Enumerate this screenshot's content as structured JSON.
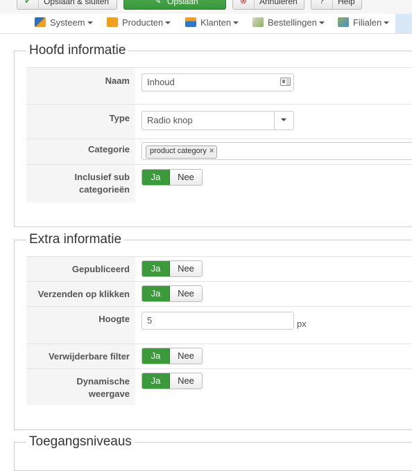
{
  "toolbar": {
    "save_close_label": "Opslaan & sluiten",
    "save_label": "Opslaan",
    "cancel_label": "Annuleren",
    "help_label": "Help"
  },
  "menu": {
    "items": [
      {
        "label": "Systeem",
        "icon": "tools-icon",
        "color": "#2f6fb3"
      },
      {
        "label": "Producten",
        "icon": "box-icon",
        "color": "#f0a01e"
      },
      {
        "label": "Klanten",
        "icon": "users-icon",
        "color": "#2e78c8"
      },
      {
        "label": "Bestellingen",
        "icon": "orders-icon",
        "color": "#8bb05a"
      },
      {
        "label": "Filialen",
        "icon": "stores-icon",
        "color": "#4a8fd0"
      }
    ]
  },
  "main_info": {
    "legend": "Hoofd informatie",
    "name_label": "Naam",
    "name_value": "Inhoud",
    "type_label": "Type",
    "type_value": "Radio knop",
    "category_label": "Categorie",
    "category_tag": "product category",
    "include_sub_label_1": "Inclusief sub",
    "include_sub_label_2": "categorieën",
    "yes": "Ja",
    "no": "Nee"
  },
  "extra_info": {
    "legend": "Extra informatie",
    "published_label": "Gepubliceerd",
    "submit_on_click_label": "Verzenden op klikken",
    "height_label": "Hoogte",
    "height_value": "5",
    "height_unit": "px",
    "removable_label": "Verwijderbare filter",
    "dynamic_label_1": "Dynamische",
    "dynamic_label_2": "weergave",
    "yes": "Ja",
    "no": "Nee"
  },
  "access": {
    "legend": "Toegangsniveaus"
  },
  "colors": {
    "active_green": "#3c9a3c",
    "label_bg": "#f5f5f5"
  }
}
